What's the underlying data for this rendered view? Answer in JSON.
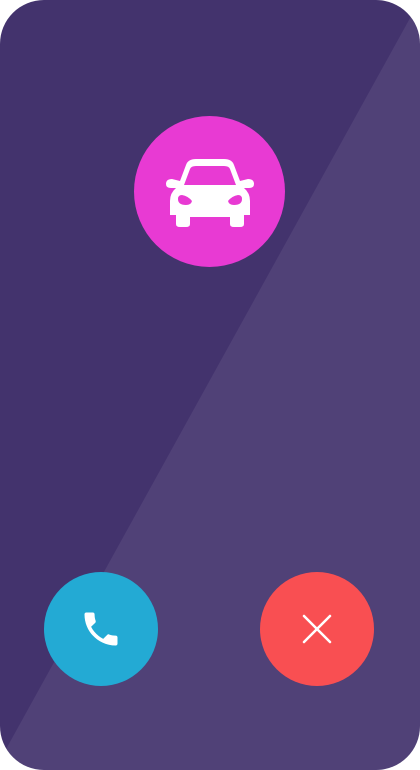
{
  "screen": {
    "background_color": "#43336d",
    "shine_color": "#ffffff"
  },
  "caller": {
    "avatar_icon": "car-icon",
    "avatar_color": "#e83ad3",
    "icon_color": "#ffffff"
  },
  "actions": {
    "accept": {
      "icon": "phone-icon",
      "color": "#23aad4"
    },
    "decline": {
      "icon": "close-icon",
      "color": "#f94f52"
    }
  }
}
